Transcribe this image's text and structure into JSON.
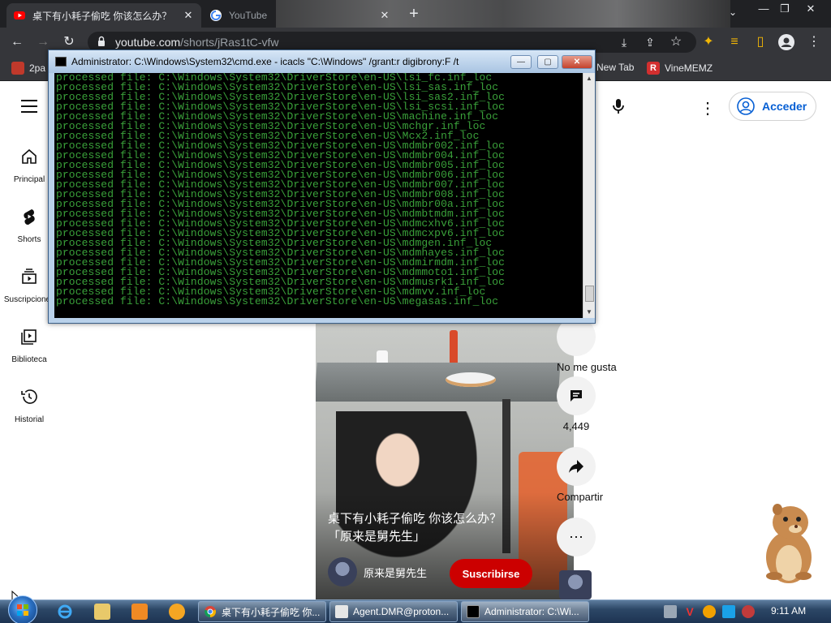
{
  "browser": {
    "tabs": [
      {
        "title": "桌下有小耗子偷吃 你该怎么办？",
        "close": "✕",
        "active": true
      },
      {
        "title": "YouTube",
        "close": "✕",
        "active": false
      }
    ],
    "new_tab": "+",
    "url_host": "youtube.com",
    "url_path": "/shorts/jRas1tC-vfw",
    "bookmarks": [
      {
        "label": "2pa"
      },
      {
        "label": "New Tab"
      },
      {
        "label": "VineMEMZ"
      }
    ]
  },
  "cmd": {
    "title": "Administrator: C:\\Windows\\System32\\cmd.exe - icacls  \"C:\\Windows\" /grant:r digibrony:F /t",
    "minimize": "—",
    "maximize": "▢",
    "close": "✕",
    "lines": [
      "processed file: C:\\Windows\\System32\\DriverStore\\en-US\\lsi_fc.inf_loc",
      "processed file: C:\\Windows\\System32\\DriverStore\\en-US\\lsi_sas.inf_loc",
      "processed file: C:\\Windows\\System32\\DriverStore\\en-US\\lsi_sas2.inf_loc",
      "processed file: C:\\Windows\\System32\\DriverStore\\en-US\\lsi_scsi.inf_loc",
      "processed file: C:\\Windows\\System32\\DriverStore\\en-US\\machine.inf_loc",
      "processed file: C:\\Windows\\System32\\DriverStore\\en-US\\mchgr.inf_loc",
      "processed file: C:\\Windows\\System32\\DriverStore\\en-US\\Mcx2.inf_loc",
      "processed file: C:\\Windows\\System32\\DriverStore\\en-US\\mdmbr002.inf_loc",
      "processed file: C:\\Windows\\System32\\DriverStore\\en-US\\mdmbr004.inf_loc",
      "processed file: C:\\Windows\\System32\\DriverStore\\en-US\\mdmbr005.inf_loc",
      "processed file: C:\\Windows\\System32\\DriverStore\\en-US\\mdmbr006.inf_loc",
      "processed file: C:\\Windows\\System32\\DriverStore\\en-US\\mdmbr007.inf_loc",
      "processed file: C:\\Windows\\System32\\DriverStore\\en-US\\mdmbr008.inf_loc",
      "processed file: C:\\Windows\\System32\\DriverStore\\en-US\\mdmbr00a.inf_loc",
      "processed file: C:\\Windows\\System32\\DriverStore\\en-US\\mdmbtmdm.inf_loc",
      "processed file: C:\\Windows\\System32\\DriverStore\\en-US\\mdmcxhv6.inf_loc",
      "processed file: C:\\Windows\\System32\\DriverStore\\en-US\\mdmcxpv6.inf_loc",
      "processed file: C:\\Windows\\System32\\DriverStore\\en-US\\mdmgen.inf_loc",
      "processed file: C:\\Windows\\System32\\DriverStore\\en-US\\mdmhayes.inf_loc",
      "processed file: C:\\Windows\\System32\\DriverStore\\en-US\\mdmirmdm.inf_loc",
      "processed file: C:\\Windows\\System32\\DriverStore\\en-US\\mdmmoto1.inf_loc",
      "processed file: C:\\Windows\\System32\\DriverStore\\en-US\\mdmusrk1.inf_loc",
      "processed file: C:\\Windows\\System32\\DriverStore\\en-US\\mdmvv.inf_loc",
      "processed file: C:\\Windows\\System32\\DriverStore\\en-US\\megasas.inf_loc"
    ]
  },
  "youtube": {
    "nav": [
      {
        "label": "Principal",
        "icon": "home-icon"
      },
      {
        "label": "Shorts",
        "icon": "shorts-icon"
      },
      {
        "label": "Suscripciones",
        "icon": "subscriptions-icon"
      },
      {
        "label": "Biblioteca",
        "icon": "library-icon"
      },
      {
        "label": "Historial",
        "icon": "history-icon"
      }
    ],
    "signin_label": "Acceder",
    "short": {
      "caption_line1": "桌下有小耗子偷吃 你该怎么办？",
      "caption_line2": "「原来是舅先生」",
      "channel": "原来是舅先生",
      "subscribe": "Suscribirse"
    },
    "actions": {
      "like_label": "No me gusta",
      "comments_count": "4,449",
      "share_label": "Compartir"
    }
  },
  "taskbar": {
    "buttons": [
      {
        "label": "桌下有小耗子偷吃 你..."
      },
      {
        "label": "Agent.DMR@proton..."
      },
      {
        "label": "Administrator: C:\\Wi..."
      }
    ],
    "clock": "9:11 AM"
  },
  "colors": {
    "console_text": "#3aa13a",
    "youtube_red": "#cc0000",
    "signin_blue": "#065fd4"
  }
}
